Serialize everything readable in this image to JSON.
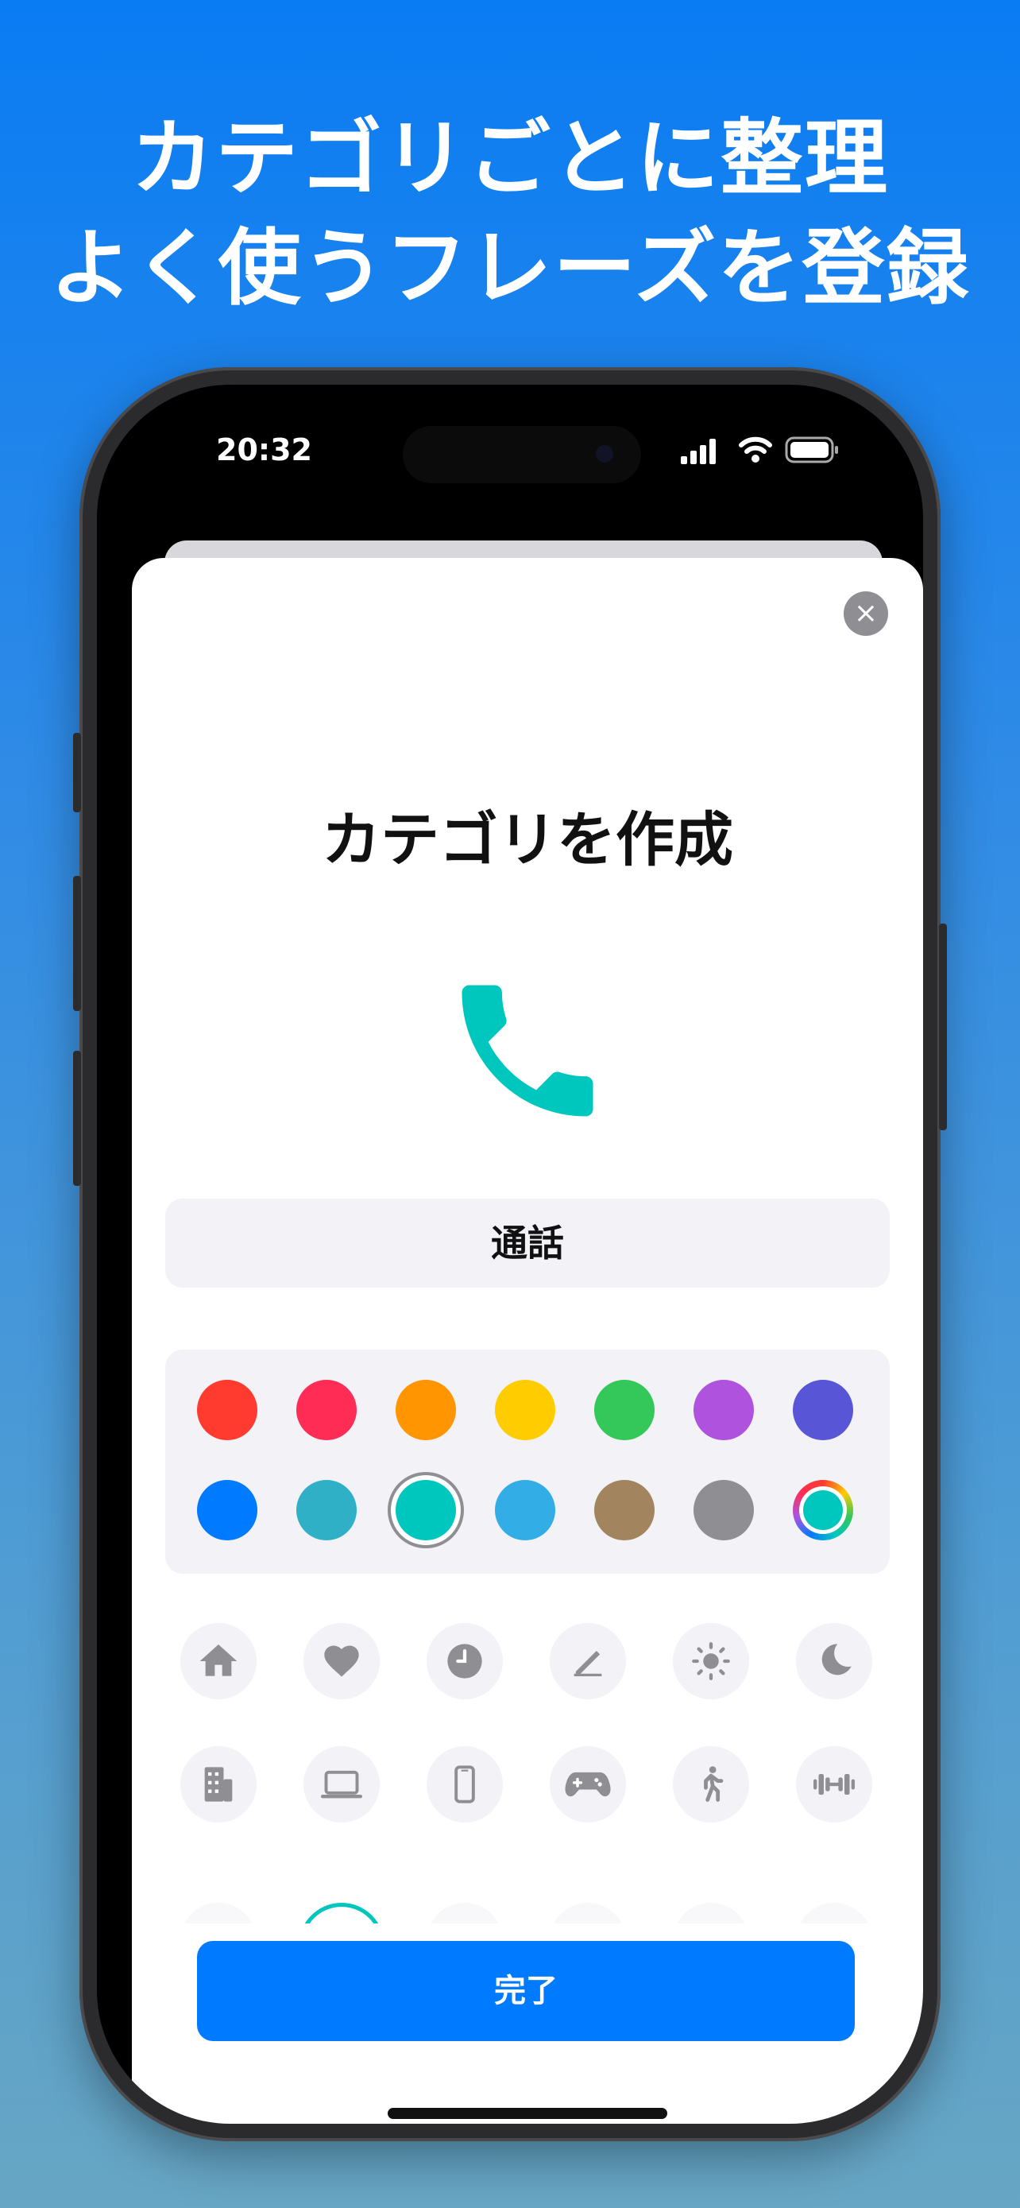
{
  "headline": {
    "line1": "カテゴリごとに整理",
    "line2": "よく使うフレーズを登録"
  },
  "status_bar": {
    "time": "20:32",
    "icons": [
      "cellular-signal-icon",
      "wifi-icon",
      "battery-icon"
    ]
  },
  "sheet": {
    "close_icon": "×",
    "title": "カテゴリを作成",
    "selected_icon": "phone-icon",
    "selected_color": "#00c7be",
    "name_value": "通話",
    "done_label": "完了"
  },
  "colors": [
    "#ff3b30",
    "#ff2d55",
    "#ff9500",
    "#ffcc00",
    "#34c759",
    "#af52de",
    "#5856d6",
    "#007aff",
    "#30b0c7",
    "#00c7be",
    "#32ade6",
    "#a2845e",
    "#8e8e93",
    "custom-color-picker"
  ],
  "icons": [
    "house-icon",
    "heart-icon",
    "clock-icon",
    "pencil-icon",
    "sun-icon",
    "moon-icon",
    "building-icon",
    "laptop-icon",
    "smartphone-icon",
    "gamecontroller-icon",
    "walking-icon",
    "dumbbell-icon"
  ]
}
